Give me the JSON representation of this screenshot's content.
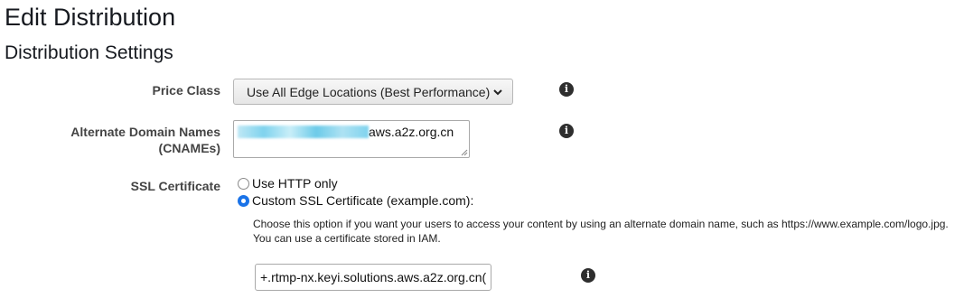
{
  "page": {
    "title": "Edit Distribution",
    "section_title": "Distribution Settings"
  },
  "price_class": {
    "label": "Price Class",
    "selected": "Use All Edge Locations (Best Performance)",
    "icons": {
      "dropdown": "chevron-down-icon",
      "info": "info-icon"
    }
  },
  "cnames": {
    "label_line1": "Alternate Domain Names",
    "label_line2": "(CNAMEs)",
    "value_visible": "aws.a2z.org.cn",
    "icons": {
      "info": "info-icon"
    }
  },
  "ssl": {
    "label": "SSL Certificate",
    "options": [
      {
        "label": "Use HTTP only",
        "selected": false
      },
      {
        "label": "Custom SSL Certificate (example.com):",
        "selected": true
      }
    ],
    "help_line1": "Choose this option if you want your users to access your content by using an alternate domain name, such as https://www.example.com/logo.jpg.",
    "help_line2": "You can use a certificate stored in IAM.",
    "certificate_value": "+.rtmp-nx.keyi.solutions.aws.a2z.org.cn(",
    "icons": {
      "info": "info-icon"
    }
  },
  "colors": {
    "radio_selected": "#1a73e8",
    "info_icon": "#2e2e2e",
    "text": "#16191f"
  }
}
